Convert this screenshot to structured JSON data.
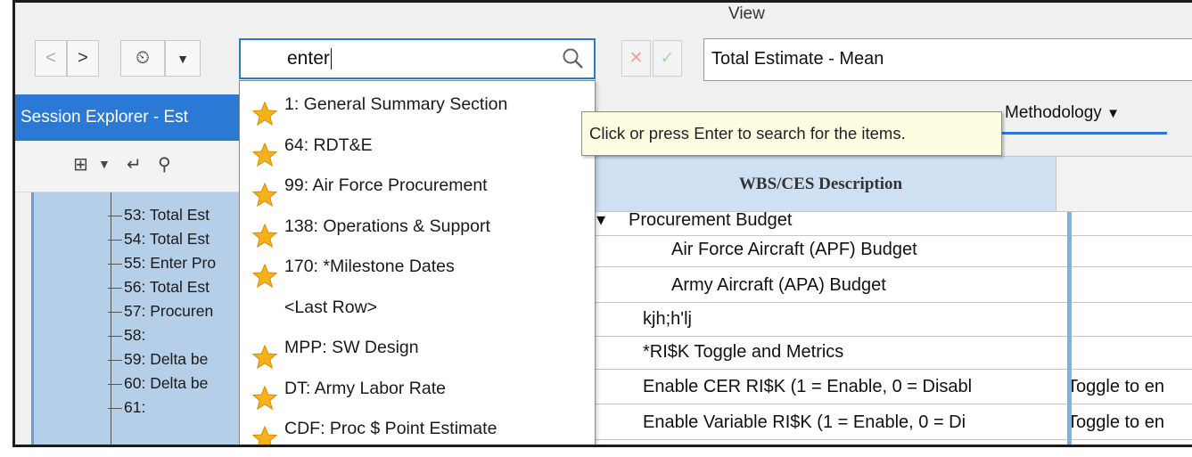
{
  "window": {
    "view_label": "View"
  },
  "toolbar": {
    "back_glyph": "<",
    "forward_glyph": ">",
    "history_glyph": "⏲",
    "history_dropdown_glyph": "▼",
    "cancel_glyph": "✕",
    "accept_glyph": "✓"
  },
  "search": {
    "value": "enter"
  },
  "formula_bar": {
    "value": "Total Estimate - Mean"
  },
  "tooltip": {
    "text": "Click or press Enter to search for the items."
  },
  "session_explorer": {
    "title": "Session Explorer - Est",
    "tree_items": [
      "53: Total Est",
      "54: Total Est",
      "55: Enter Pro",
      "56: Total Est",
      "57: Procuren",
      "58:",
      "59: Delta be",
      "60: Delta be",
      "61:"
    ]
  },
  "search_results": [
    {
      "label": "1: General Summary Section",
      "starred": true
    },
    {
      "label": "64: RDT&E",
      "starred": true
    },
    {
      "label": "99: Air Force Procurement",
      "starred": true
    },
    {
      "label": "138: Operations & Support",
      "starred": true
    },
    {
      "label": "170: *Milestone Dates",
      "starred": true
    },
    {
      "label": "<Last Row>",
      "starred": false
    },
    {
      "label": "MPP: SW Design",
      "starred": true
    },
    {
      "label": "DT: Army Labor Rate",
      "starred": true
    },
    {
      "label": "CDF: Proc $  Point Estimate",
      "starred": true
    }
  ],
  "grid": {
    "methodology_tab": "Methodology",
    "methodology_glyph": "▼",
    "header_description": "WBS/CES Description",
    "rows": [
      {
        "prefix": "▾",
        "description": "Procurement Budget",
        "note": ""
      },
      {
        "prefix": "",
        "description": "Air Force Aircraft (APF) Budget",
        "note": ""
      },
      {
        "prefix": "",
        "description": "Army Aircraft (APA) Budget",
        "note": ""
      },
      {
        "prefix": "",
        "description": "kjh;h'lj",
        "note": ""
      },
      {
        "prefix": "",
        "description": "*RI$K Toggle and Metrics",
        "note": ""
      },
      {
        "prefix": "",
        "description": "Enable CER RI$K (1 = Enable, 0 = Disabl",
        "note": "Toggle to en"
      },
      {
        "prefix": "",
        "description": "Enable Variable RI$K (1 = Enable, 0 = Di",
        "note": "Toggle to en"
      }
    ]
  },
  "colors": {
    "accent": "#2a79d4",
    "tree_bg": "#b5cfe8",
    "tooltip_bg": "#fdfde2",
    "star": "#f5b21b"
  }
}
